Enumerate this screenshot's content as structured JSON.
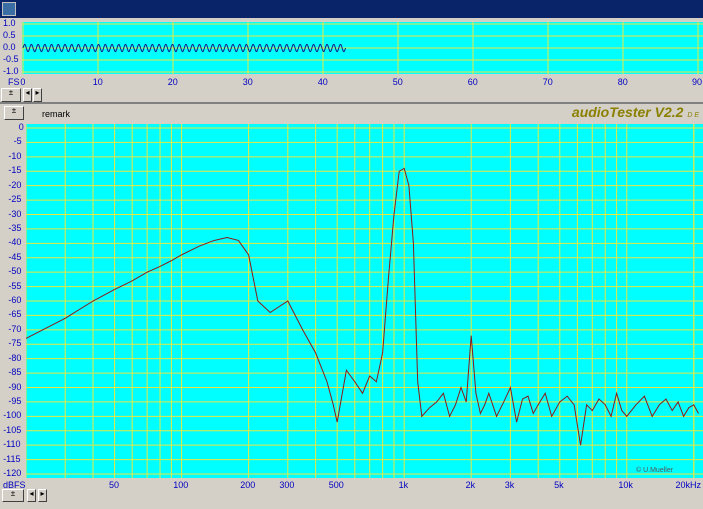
{
  "window": {
    "title": ""
  },
  "icons": {
    "app": "audiotester-app-icon"
  },
  "scope": {
    "y_labels": [
      "1.0",
      "0.5",
      "0.0",
      "-0.5",
      "-1.0"
    ],
    "fs_label": "FS",
    "x_labels": [
      "0",
      "10",
      "20",
      "30",
      "40",
      "50",
      "60",
      "70",
      "80",
      "90"
    ]
  },
  "spectrum": {
    "remark": "remark",
    "brand": "audioTester V2.2",
    "brand_suffix": "D E",
    "credit": "© U.Mueller",
    "unit_label": "dBFS",
    "y_labels": [
      "0",
      "-5",
      "-10",
      "-15",
      "-20",
      "-25",
      "-30",
      "-35",
      "-40",
      "-45",
      "-50",
      "-55",
      "-60",
      "-65",
      "-70",
      "-75",
      "-80",
      "-85",
      "-90",
      "-95",
      "-100",
      "-105",
      "-110",
      "-115",
      "-120"
    ],
    "x_labels": [
      "50",
      "100",
      "200",
      "300",
      "500",
      "1k",
      "2k",
      "3k",
      "5k",
      "10k",
      "20kHz"
    ]
  },
  "colors": {
    "background": "#00ffff",
    "grid": "#e8e840",
    "trace": "#8b1a1a",
    "scope_trace": "#1a1a80"
  },
  "chart_data": [
    {
      "type": "line",
      "title": "",
      "xlabel": "",
      "ylabel": "",
      "xlim": [
        0,
        90
      ],
      "ylim": [
        -1.0,
        1.0
      ],
      "grid": true,
      "series": [
        {
          "name": "",
          "x_range": [
            0,
            43
          ],
          "amplitude": 0.15,
          "cycles": 48
        }
      ]
    },
    {
      "type": "line",
      "title": "",
      "xlabel": "",
      "ylabel": "dBFS",
      "xscale": "log",
      "xlim": [
        20,
        22000
      ],
      "ylim": [
        -120,
        0
      ],
      "grid": true,
      "series": [
        {
          "name": "",
          "x": [
            20,
            30,
            40,
            50,
            60,
            70,
            80,
            90,
            100,
            120,
            140,
            160,
            180,
            200,
            220,
            250,
            300,
            350,
            400,
            450,
            480,
            500,
            550,
            600,
            650,
            700,
            750,
            800,
            850,
            900,
            950,
            1000,
            1050,
            1100,
            1150,
            1200,
            1300,
            1400,
            1500,
            1600,
            1700,
            1800,
            1900,
            2000,
            2100,
            2200,
            2300,
            2400,
            2600,
            2800,
            3000,
            3200,
            3400,
            3600,
            3800,
            4000,
            4300,
            4600,
            5000,
            5400,
            5800,
            6200,
            6600,
            7000,
            7500,
            8000,
            8500,
            9000,
            9500,
            10000,
            11000,
            12000,
            13000,
            14000,
            15000,
            16000,
            17000,
            18000,
            19000,
            20000,
            21000
          ],
          "y": [
            -73,
            -66,
            -60,
            -56,
            -53,
            -50,
            -48,
            -46,
            -44,
            -41,
            -39,
            -38,
            -39,
            -44,
            -60,
            -64,
            -60,
            -70,
            -78,
            -88,
            -96,
            -102,
            -84,
            -88,
            -92,
            -86,
            -88,
            -78,
            -52,
            -30,
            -15,
            -14,
            -20,
            -40,
            -88,
            -100,
            -97,
            -95,
            -92,
            -100,
            -96,
            -90,
            -95,
            -72,
            -92,
            -99,
            -96,
            -92,
            -100,
            -95,
            -90,
            -102,
            -94,
            -93,
            -99,
            -96,
            -92,
            -100,
            -95,
            -93,
            -96,
            -110,
            -96,
            -98,
            -94,
            -96,
            -100,
            -92,
            -98,
            -100,
            -96,
            -93,
            -100,
            -96,
            -94,
            -98,
            -95,
            -100,
            -97,
            -96,
            -99
          ]
        }
      ]
    }
  ]
}
